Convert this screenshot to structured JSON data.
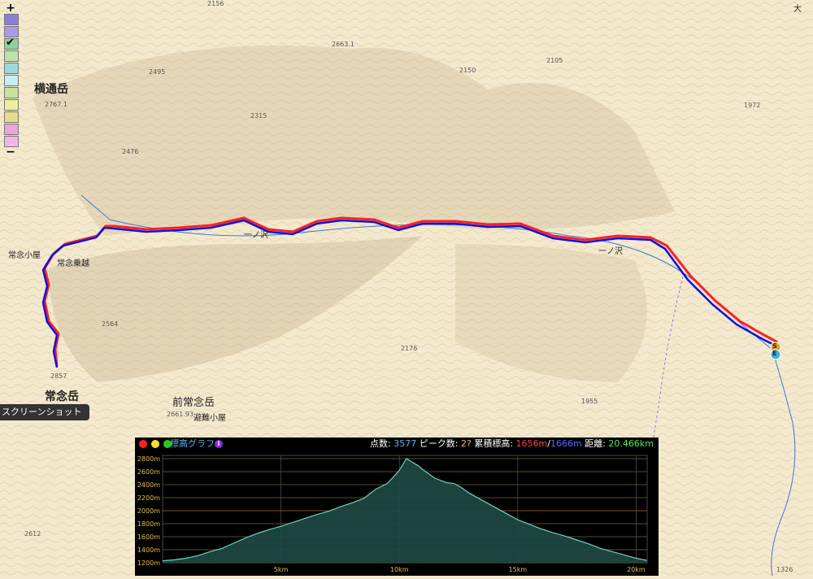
{
  "map": {
    "labels": {
      "yokotoori": "横通岳",
      "jonen_hut": "常念小屋",
      "jonen_norikoshi": "常念乗越",
      "jonen": "常念岳",
      "maejonen": "前常念岳",
      "hinan_hut": "避難小屋",
      "ichinosawa_1": "一ノ沢",
      "ichinosawa_2": "一ノ沢",
      "top_right": "大",
      "start_marker": "S",
      "end_marker": "E"
    },
    "spot_heights": {
      "h2767": "2767.1",
      "h2495": "2495",
      "h2315": "2315",
      "h2476": "2476",
      "h2150": "2150",
      "h2105": "2105",
      "h1972": "1972",
      "h2564": "2564",
      "h2857": "2857",
      "h2176": "2176",
      "h1955": "1955",
      "h2661": "2661.93",
      "h2663": "2663.1",
      "h2612": "2612",
      "h1326": "1326",
      "h2156": "2156"
    }
  },
  "palette": {
    "plus_label": "+",
    "minus_label": "−",
    "check_mark": "✔",
    "colors": [
      "#8a7fd6",
      "#a99be8",
      "#8fd19a",
      "#b5e6a9",
      "#9bd9dc",
      "#c4eef0",
      "#c5e39a",
      "#ecef9a",
      "#e9d98a",
      "#e9a6d6",
      "#f2b6e6"
    ]
  },
  "screenshot_button": "スクリーンショット",
  "elevation_panel": {
    "dots": [
      "#ff2020",
      "#ffe020",
      "#22cc22"
    ],
    "title": "標高グラフ",
    "info": "i",
    "points_label": "点数:",
    "points_value": "3577",
    "peaks_label": "ピーク数:",
    "peaks_value": "2?",
    "gain_label": "累積標高:",
    "gain_up": "1656m",
    "gain_sep": "/",
    "gain_down": "1666m",
    "distance_label": "距離:",
    "distance_value": "20.466km",
    "colors": {
      "up": "#ff4040",
      "down": "#4f6bff",
      "distance": "#55ee55",
      "points": "#5ab4e6",
      "peaks": "#e8c040",
      "line": "#6fd0c9"
    }
  },
  "chart_data": {
    "type": "area",
    "xlabel": "",
    "ylabel": "",
    "xlim": [
      0,
      20.466
    ],
    "ylim": [
      1200,
      2850
    ],
    "x_ticks": [
      5,
      10,
      15,
      20
    ],
    "x_tick_labels": [
      "5km",
      "10km",
      "15km",
      "20km"
    ],
    "y_ticks": [
      1200,
      1400,
      1600,
      1800,
      2000,
      2200,
      2400,
      2600,
      2800
    ],
    "y_tick_labels": [
      "1200m",
      "1400m",
      "1600m",
      "1800m",
      "2000m",
      "2200m",
      "2400m",
      "2600m",
      "2800m"
    ],
    "series": [
      {
        "x": [
          0,
          0.5,
          1,
          1.5,
          2,
          2.5,
          3,
          3.5,
          4,
          4.5,
          5,
          5.5,
          6,
          6.5,
          7,
          7.5,
          8,
          8.5,
          9,
          9.5,
          10,
          10.3,
          10.8,
          11,
          11.5,
          12,
          12.3,
          12.6,
          13,
          13.5,
          14,
          14.5,
          15,
          15.5,
          16,
          16.5,
          17,
          17.5,
          18,
          18.5,
          19,
          19.5,
          20,
          20.466
        ],
        "y": [
          1230,
          1245,
          1270,
          1310,
          1370,
          1420,
          1500,
          1580,
          1650,
          1710,
          1760,
          1820,
          1880,
          1940,
          1990,
          2060,
          2120,
          2190,
          2330,
          2420,
          2620,
          2800,
          2690,
          2630,
          2500,
          2430,
          2420,
          2360,
          2260,
          2160,
          2060,
          1960,
          1860,
          1790,
          1720,
          1660,
          1610,
          1550,
          1490,
          1420,
          1370,
          1320,
          1270,
          1235
        ]
      }
    ]
  }
}
